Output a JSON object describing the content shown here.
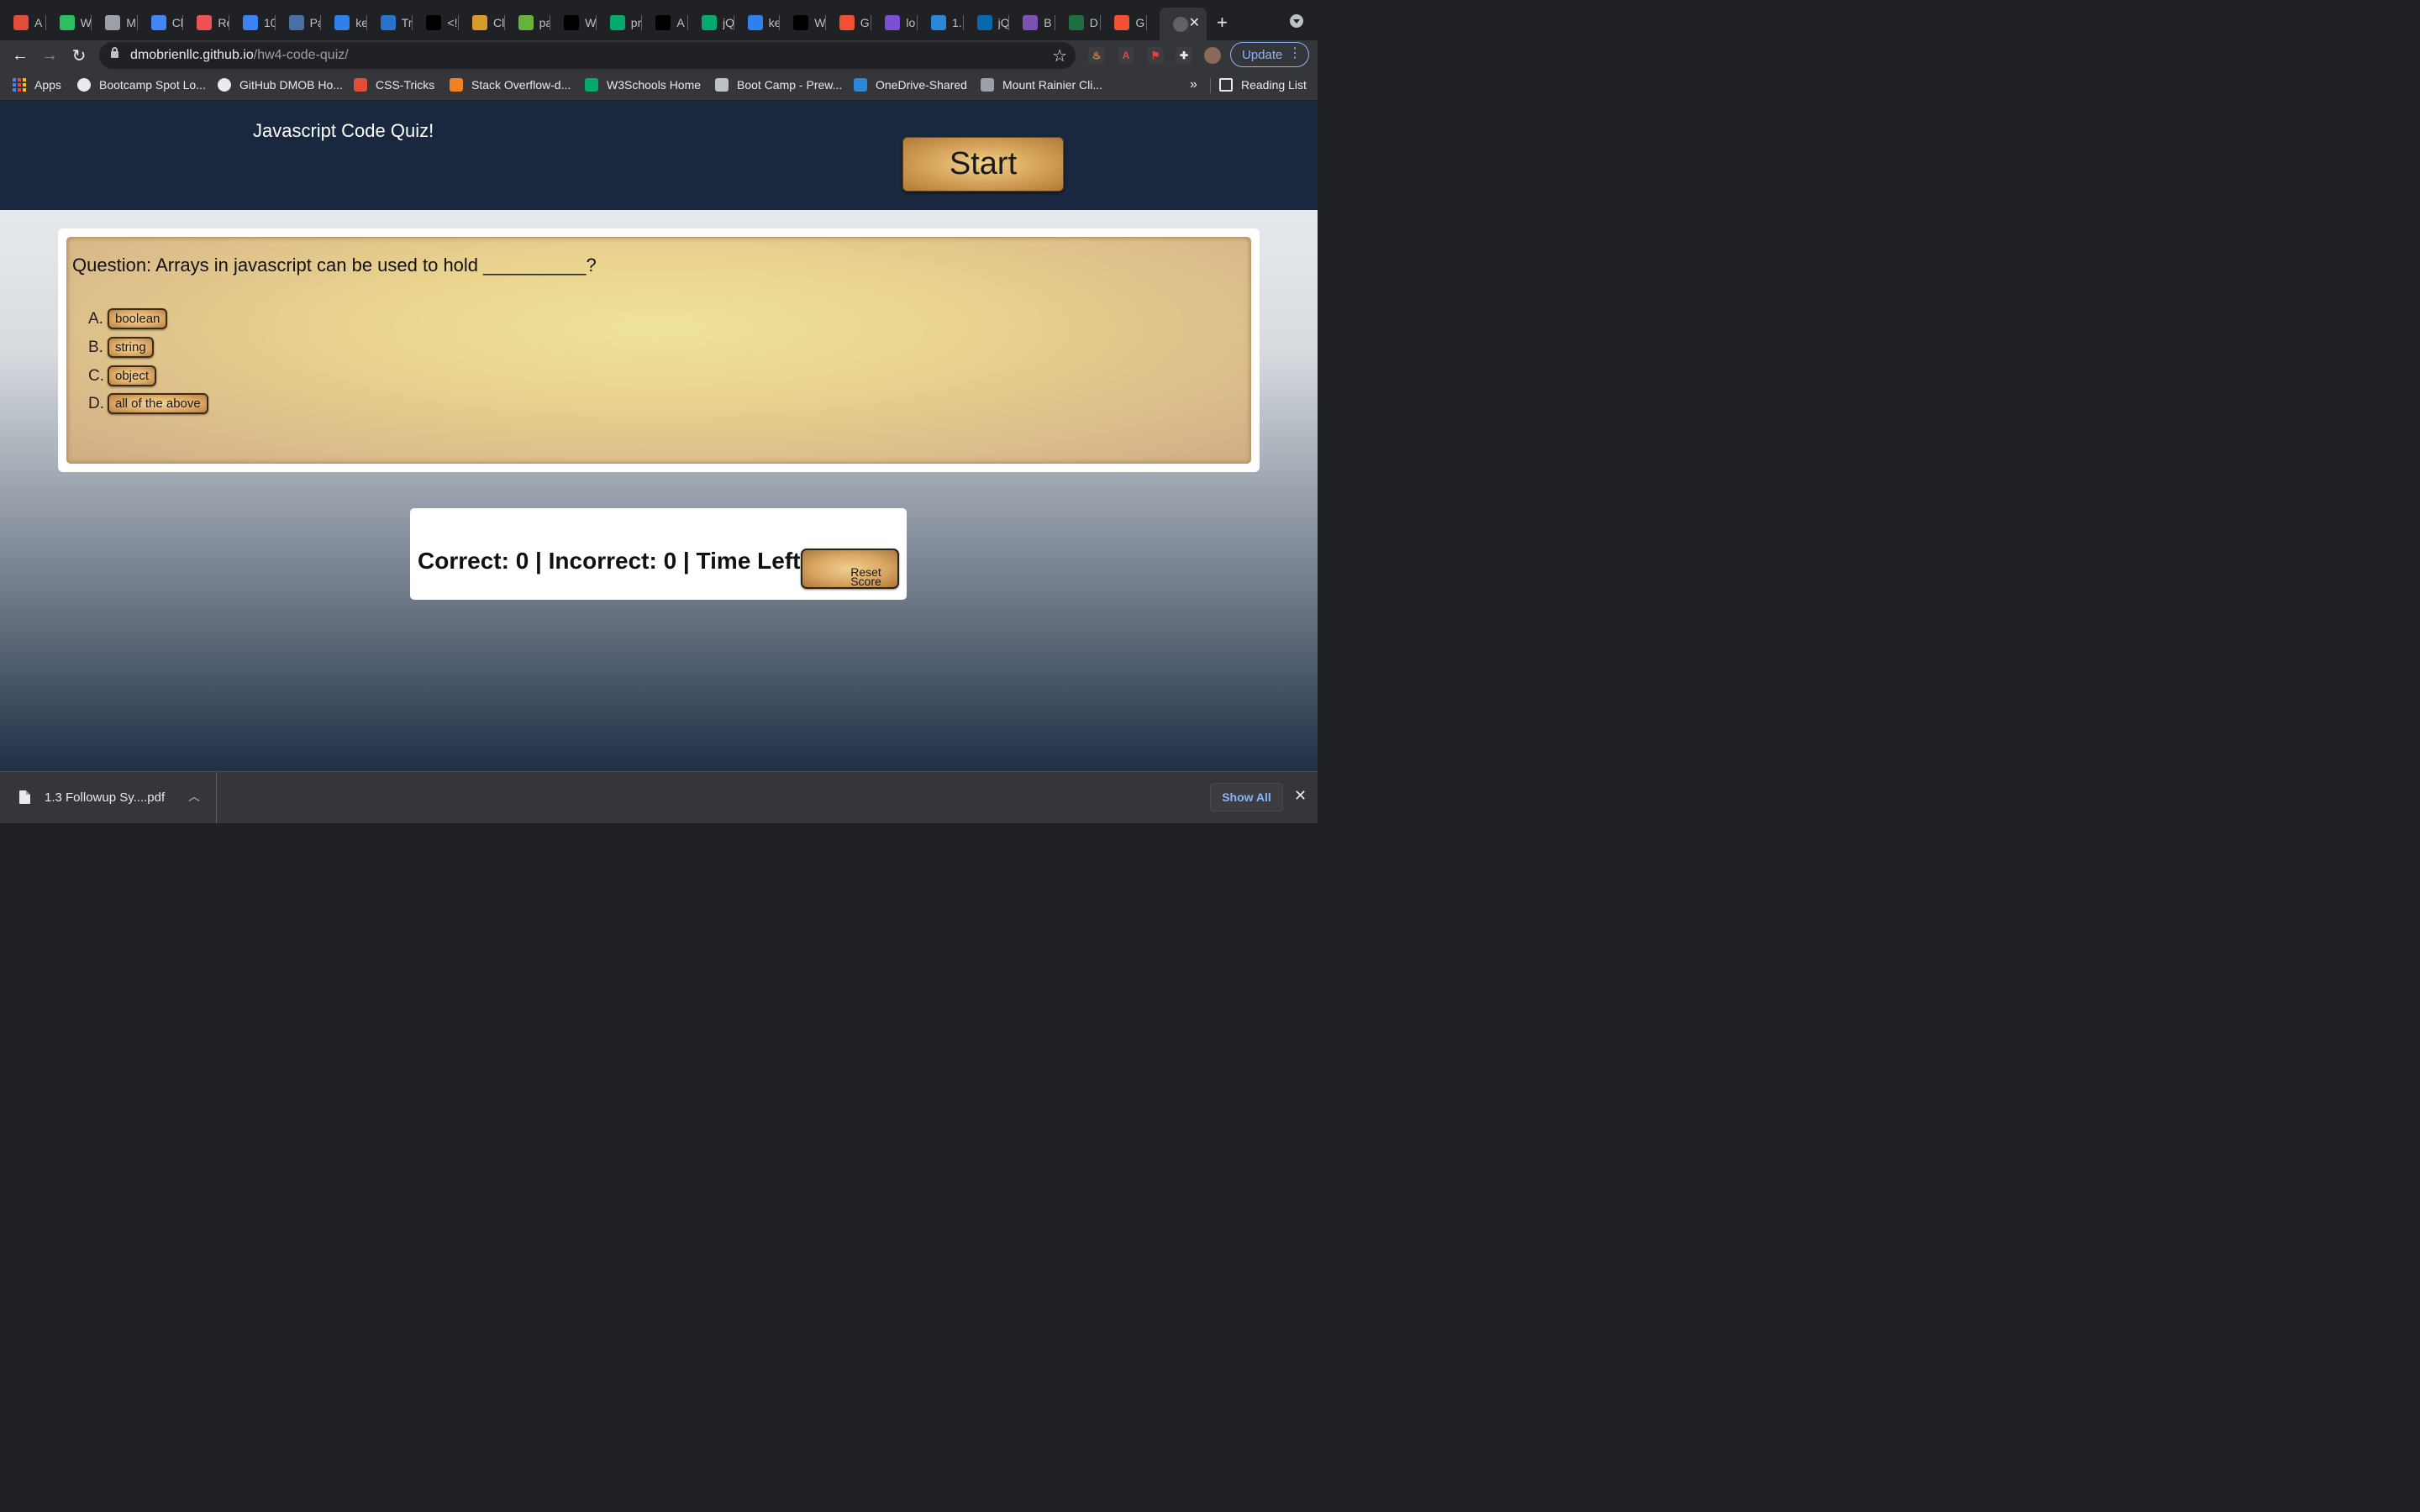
{
  "browser": {
    "tabs": [
      {
        "title": "A",
        "icon": "asterisk-icon",
        "color": "#e44c3a"
      },
      {
        "title": "W",
        "icon": "evernote-icon",
        "color": "#2dbe60"
      },
      {
        "title": "M",
        "icon": "apple-icon",
        "color": "#9aa0a6"
      },
      {
        "title": "Cl",
        "icon": "chrome-icon",
        "color": "#4285f4"
      },
      {
        "title": "Re",
        "icon": "udemy-icon",
        "color": "#ec5252"
      },
      {
        "title": "10",
        "icon": "terminal-icon",
        "color": "#3b82f6"
      },
      {
        "title": "Pa",
        "icon": "code-file-icon",
        "color": "#4a6fa5"
      },
      {
        "title": "ke",
        "icon": "vscode-icon",
        "color": "#2f80ed"
      },
      {
        "title": "Tr",
        "icon": "coursera-icon",
        "color": "#2a73cc"
      },
      {
        "title": "<!",
        "icon": "stackoverflow-bird-icon",
        "color": "#000000"
      },
      {
        "title": "Cl",
        "icon": "book-icon",
        "color": "#d69a2d"
      },
      {
        "title": "pa",
        "icon": "sparkle-icon",
        "color": "#64b33b"
      },
      {
        "title": "W",
        "icon": "stackoverflow-bird-icon",
        "color": "#000000"
      },
      {
        "title": "pr",
        "icon": "w3schools-icon",
        "color": "#04aa6d"
      },
      {
        "title": "A",
        "icon": "stackoverflow-bird-icon",
        "color": "#000000"
      },
      {
        "title": "jQ",
        "icon": "w3schools-icon",
        "color": "#04aa6d"
      },
      {
        "title": "ke",
        "icon": "vscode-icon",
        "color": "#2f80ed"
      },
      {
        "title": "W",
        "icon": "stackoverflow-bird-icon",
        "color": "#000000"
      },
      {
        "title": "G",
        "icon": "git-icon",
        "color": "#f05133"
      },
      {
        "title": "lo",
        "icon": "rocket-icon",
        "color": "#7b4fd1"
      },
      {
        "title": "1.",
        "icon": "onedrive-icon",
        "color": "#2b88d8"
      },
      {
        "title": "jQ",
        "icon": "jquery-icon",
        "color": "#0769ad"
      },
      {
        "title": "B",
        "icon": "bootstrap-icon",
        "color": "#7952b3"
      },
      {
        "title": "D",
        "icon": "excel-icon",
        "color": "#1d6f42"
      },
      {
        "title": "G",
        "icon": "git-icon",
        "color": "#f05133"
      }
    ],
    "active_tab_icon": "globe-icon",
    "url_host": "dmobrienllc.github.io",
    "url_path": "/hw4-code-quiz/",
    "update_label": "Update",
    "bookmarks": [
      {
        "label": "Apps",
        "icon": "apps-grid-icon"
      },
      {
        "label": "Bootcamp Spot Lo...",
        "icon": "globe-icon"
      },
      {
        "label": "GitHub DMOB Ho...",
        "icon": "github-icon"
      },
      {
        "label": "CSS-Tricks",
        "icon": "asterisk-icon"
      },
      {
        "label": "Stack Overflow-d...",
        "icon": "stackoverflow-icon"
      },
      {
        "label": "W3Schools Home",
        "icon": "w3schools-icon"
      },
      {
        "label": "Boot Camp - Prew...",
        "icon": "notebook-icon"
      },
      {
        "label": "OneDrive-Shared",
        "icon": "onedrive-icon"
      },
      {
        "label": "Mount Rainier Cli...",
        "icon": "mountain-icon"
      }
    ],
    "reading_list_label": "Reading List"
  },
  "page": {
    "title": "Javascript Code Quiz!",
    "start_label": "Start",
    "question": "Question: Arrays in javascript can be used to hold __________?",
    "answers": [
      {
        "letter": "A.",
        "label": "boolean"
      },
      {
        "letter": "B.",
        "label": "string"
      },
      {
        "letter": "C.",
        "label": "object"
      },
      {
        "letter": "D.",
        "label": "all of the above"
      }
    ],
    "score_text": "Correct: 0 | Incorrect: 0 | Time Left: 0",
    "reset_label_line1": "Reset",
    "reset_label_line2": "Score"
  },
  "downloads": {
    "file_name": "1.3 Followup Sy....pdf",
    "show_all_label": "Show All"
  }
}
